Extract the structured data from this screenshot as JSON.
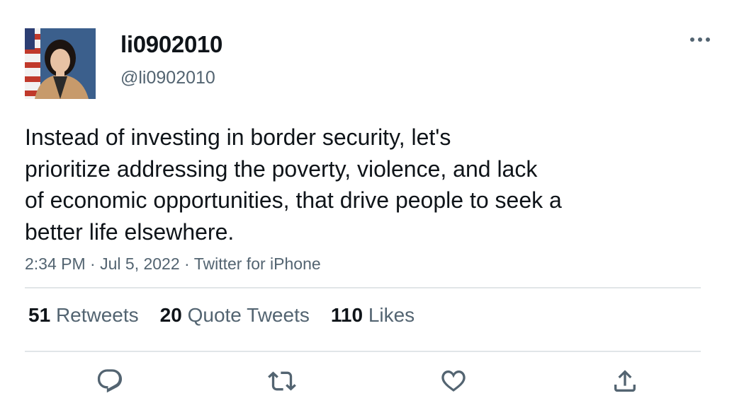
{
  "user": {
    "display_name": "li0902010",
    "handle": "@li0902010"
  },
  "tweet": {
    "lines": [
      "Instead of investing in border security, let's",
      "prioritize addressing the poverty, violence, and lack",
      "of economic opportunities, that drive people to seek a",
      "better life elsewhere."
    ],
    "time": "2:34 PM",
    "date": "Jul 5, 2022",
    "source": "Twitter for iPhone",
    "separator": "·"
  },
  "stats": {
    "retweets_count": "51",
    "retweets_label": "Retweets",
    "quotes_count": "20",
    "quotes_label": "Quote Tweets",
    "likes_count": "110",
    "likes_label": "Likes"
  },
  "icons": {
    "more": "more-horizontal-icon",
    "reply": "reply-icon",
    "retweet": "retweet-icon",
    "like": "heart-icon",
    "share": "share-icon"
  },
  "colors": {
    "text": "#0f1419",
    "secondary": "#536471",
    "divider": "#e1e5e8"
  }
}
